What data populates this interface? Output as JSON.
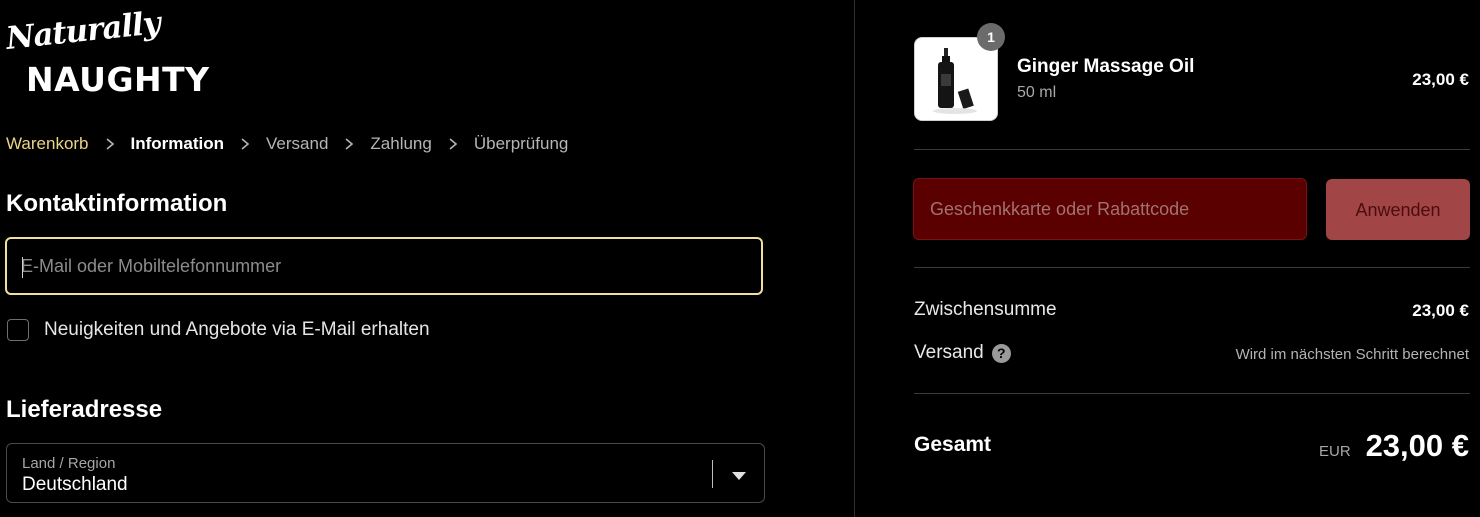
{
  "brand": {
    "logo_script": "Naturally",
    "logo_block": "NAUGHTY"
  },
  "breadcrumb": {
    "items": [
      {
        "label": "Warenkorb"
      },
      {
        "label": "Information"
      },
      {
        "label": "Versand"
      },
      {
        "label": "Zahlung"
      },
      {
        "label": "Überprüfung"
      }
    ],
    "active_index": 1
  },
  "contact": {
    "title": "Kontaktinformation",
    "email_placeholder": "E-Mail oder Mobiltelefonnummer",
    "email_value": "",
    "newsletter_label": "Neuigkeiten und Angebote via E-Mail erhalten",
    "newsletter_checked": false
  },
  "shipping_address": {
    "title": "Lieferadresse",
    "country_label": "Land / Region",
    "country_value": "Deutschland"
  },
  "summary": {
    "item": {
      "quantity": "1",
      "name": "Ginger Massage Oil",
      "variant": "50 ml",
      "price": "23,00 €"
    },
    "discount": {
      "placeholder": "Geschenkkarte oder Rabattcode",
      "button_label": "Anwenden"
    },
    "subtotal": {
      "label": "Zwischensumme",
      "value": "23,00 €"
    },
    "shipping": {
      "label": "Versand",
      "help_icon": "?",
      "value": "Wird im nächsten Schritt berechnet"
    },
    "total": {
      "label": "Gesamt",
      "currency": "EUR",
      "value": "23,00 €"
    }
  },
  "colors": {
    "background": "#000000",
    "accent": "#f1df9d",
    "discount_bg": "#5a0000",
    "apply_button": "#a14546"
  }
}
